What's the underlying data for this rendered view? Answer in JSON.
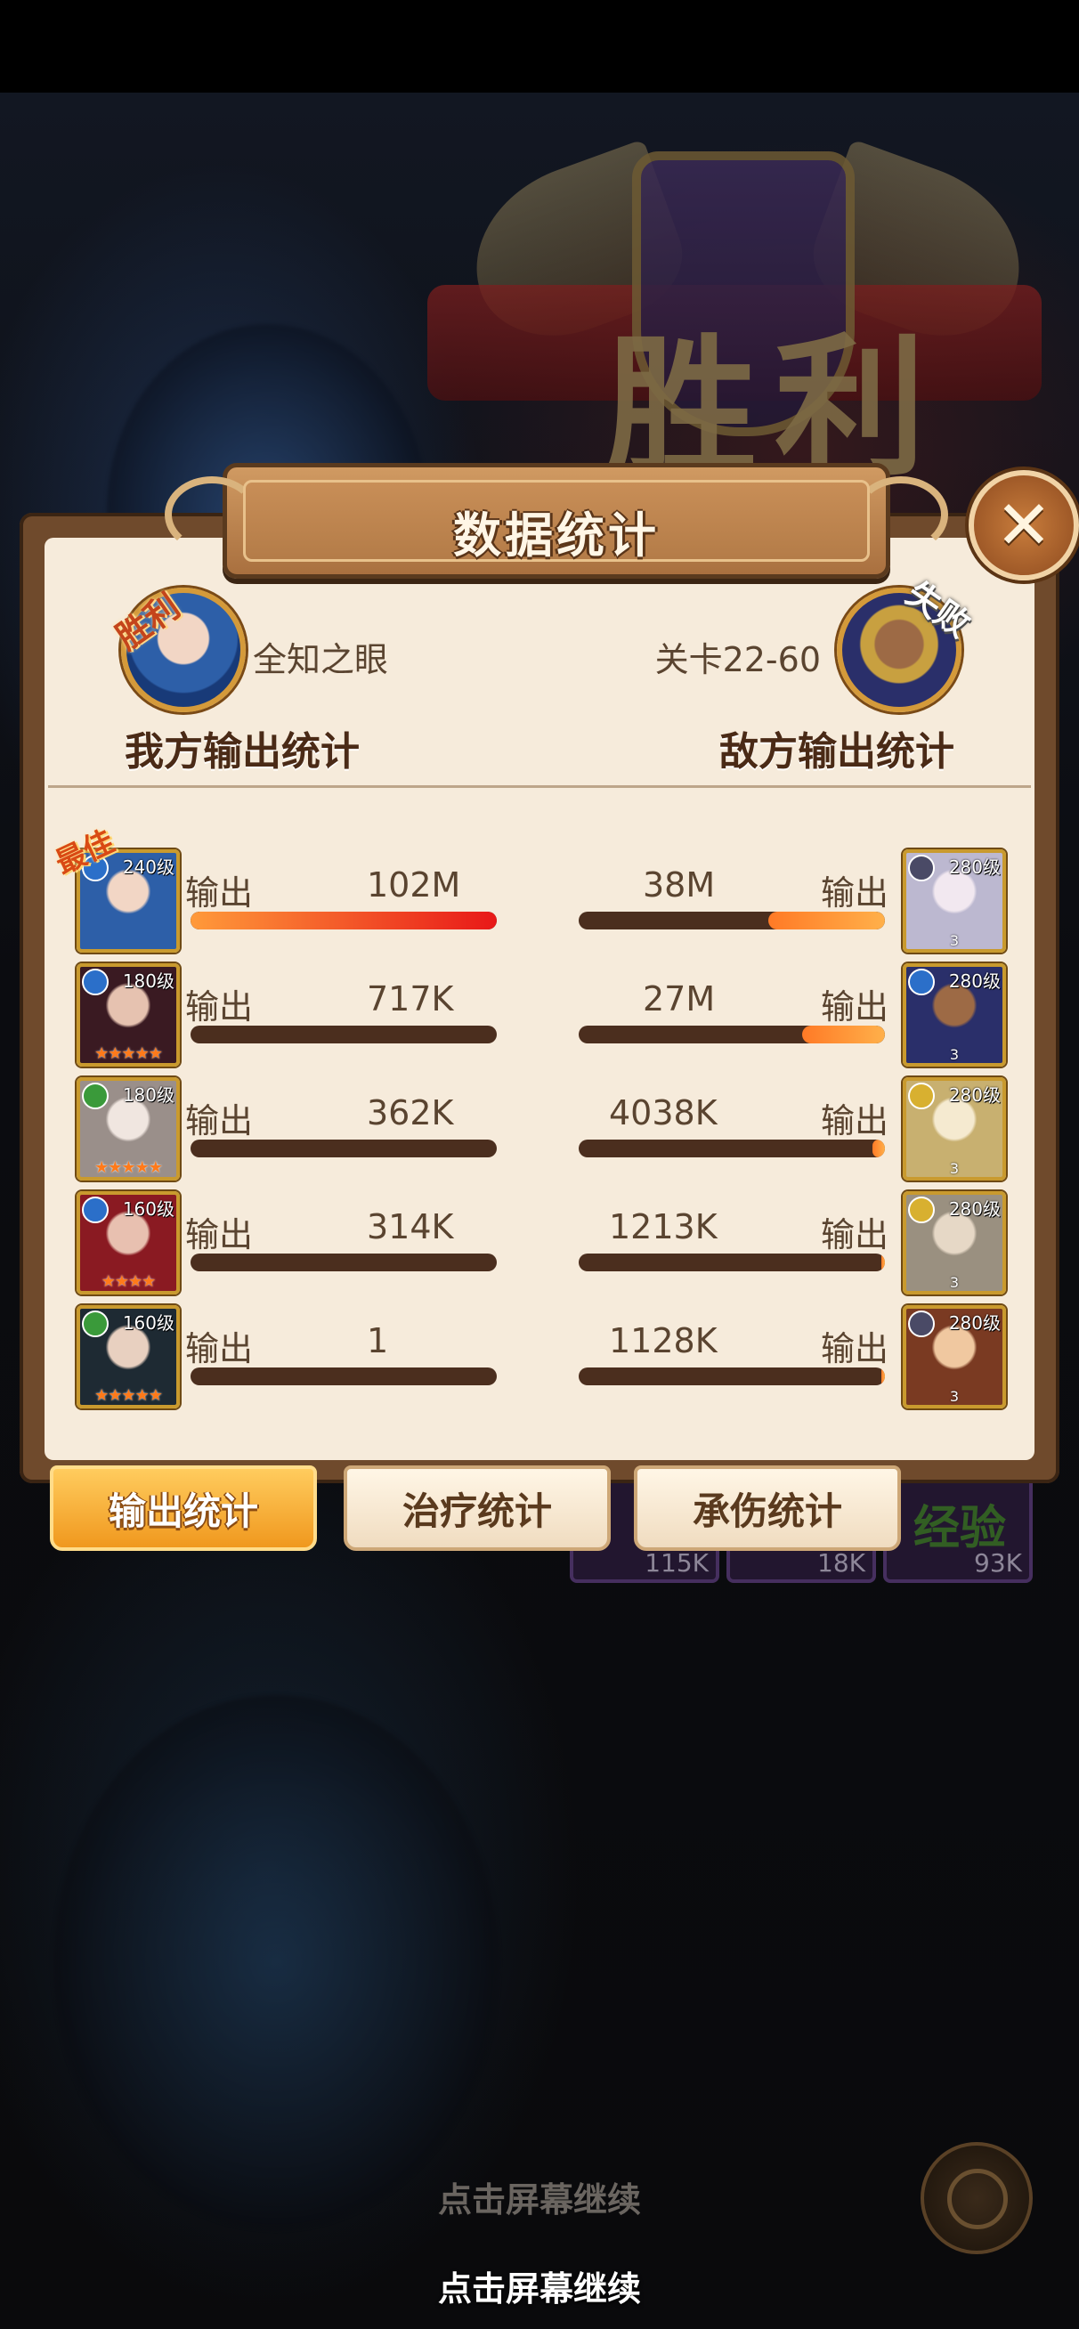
{
  "banner": {
    "text": "胜利"
  },
  "panel": {
    "title": "数据统计",
    "close_label": "✕",
    "ally": {
      "tag": "胜利",
      "name": "全知之眼",
      "section_title": "我方输出统计"
    },
    "enemy": {
      "tag": "失败",
      "stage": "关卡22-60",
      "section_title": "敌方输出统计"
    },
    "best_tag": "最佳",
    "output_label": "输出"
  },
  "ally_rows": [
    {
      "level": "240级",
      "value": "102M",
      "bar_fraction": 1.0,
      "stars": "",
      "element_color": "#2b6fc9"
    },
    {
      "level": "180级",
      "value": "717K",
      "bar_fraction": 0.0,
      "stars": "★★★★★",
      "element_color": "#2b6fc9"
    },
    {
      "level": "180级",
      "value": "362K",
      "bar_fraction": 0.0,
      "stars": "★★★★★",
      "element_color": "#3a9a3a"
    },
    {
      "level": "160级",
      "value": "314K",
      "bar_fraction": 0.0,
      "stars": "★★★★",
      "element_color": "#2b6fc9"
    },
    {
      "level": "160级",
      "value": "1",
      "bar_fraction": 0.0,
      "stars": "★★★★★",
      "element_color": "#3a9a3a"
    }
  ],
  "enemy_rows": [
    {
      "level": "280级",
      "value": "38M",
      "bar_fraction": 0.38,
      "number": "3",
      "element_color": "#4a4a66"
    },
    {
      "level": "280级",
      "value": "27M",
      "bar_fraction": 0.27,
      "number": "3",
      "element_color": "#2b6fc9"
    },
    {
      "level": "280级",
      "value": "4038K",
      "bar_fraction": 0.04,
      "number": "3",
      "element_color": "#d8b030"
    },
    {
      "level": "280级",
      "value": "1213K",
      "bar_fraction": 0.012,
      "number": "3",
      "element_color": "#d8b030"
    },
    {
      "level": "280级",
      "value": "1128K",
      "bar_fraction": 0.011,
      "number": "3",
      "element_color": "#4a4a66"
    }
  ],
  "tabs": [
    {
      "label": "输出统计",
      "active": true
    },
    {
      "label": "治疗统计",
      "active": false
    },
    {
      "label": "承伤统计",
      "active": false
    }
  ],
  "rewards": [
    {
      "value": "115K"
    },
    {
      "value": "18K"
    },
    {
      "label": "经验",
      "value": "93K"
    }
  ],
  "continue_text": "点击屏幕继续",
  "continue_text_dim": "点击屏幕继续"
}
